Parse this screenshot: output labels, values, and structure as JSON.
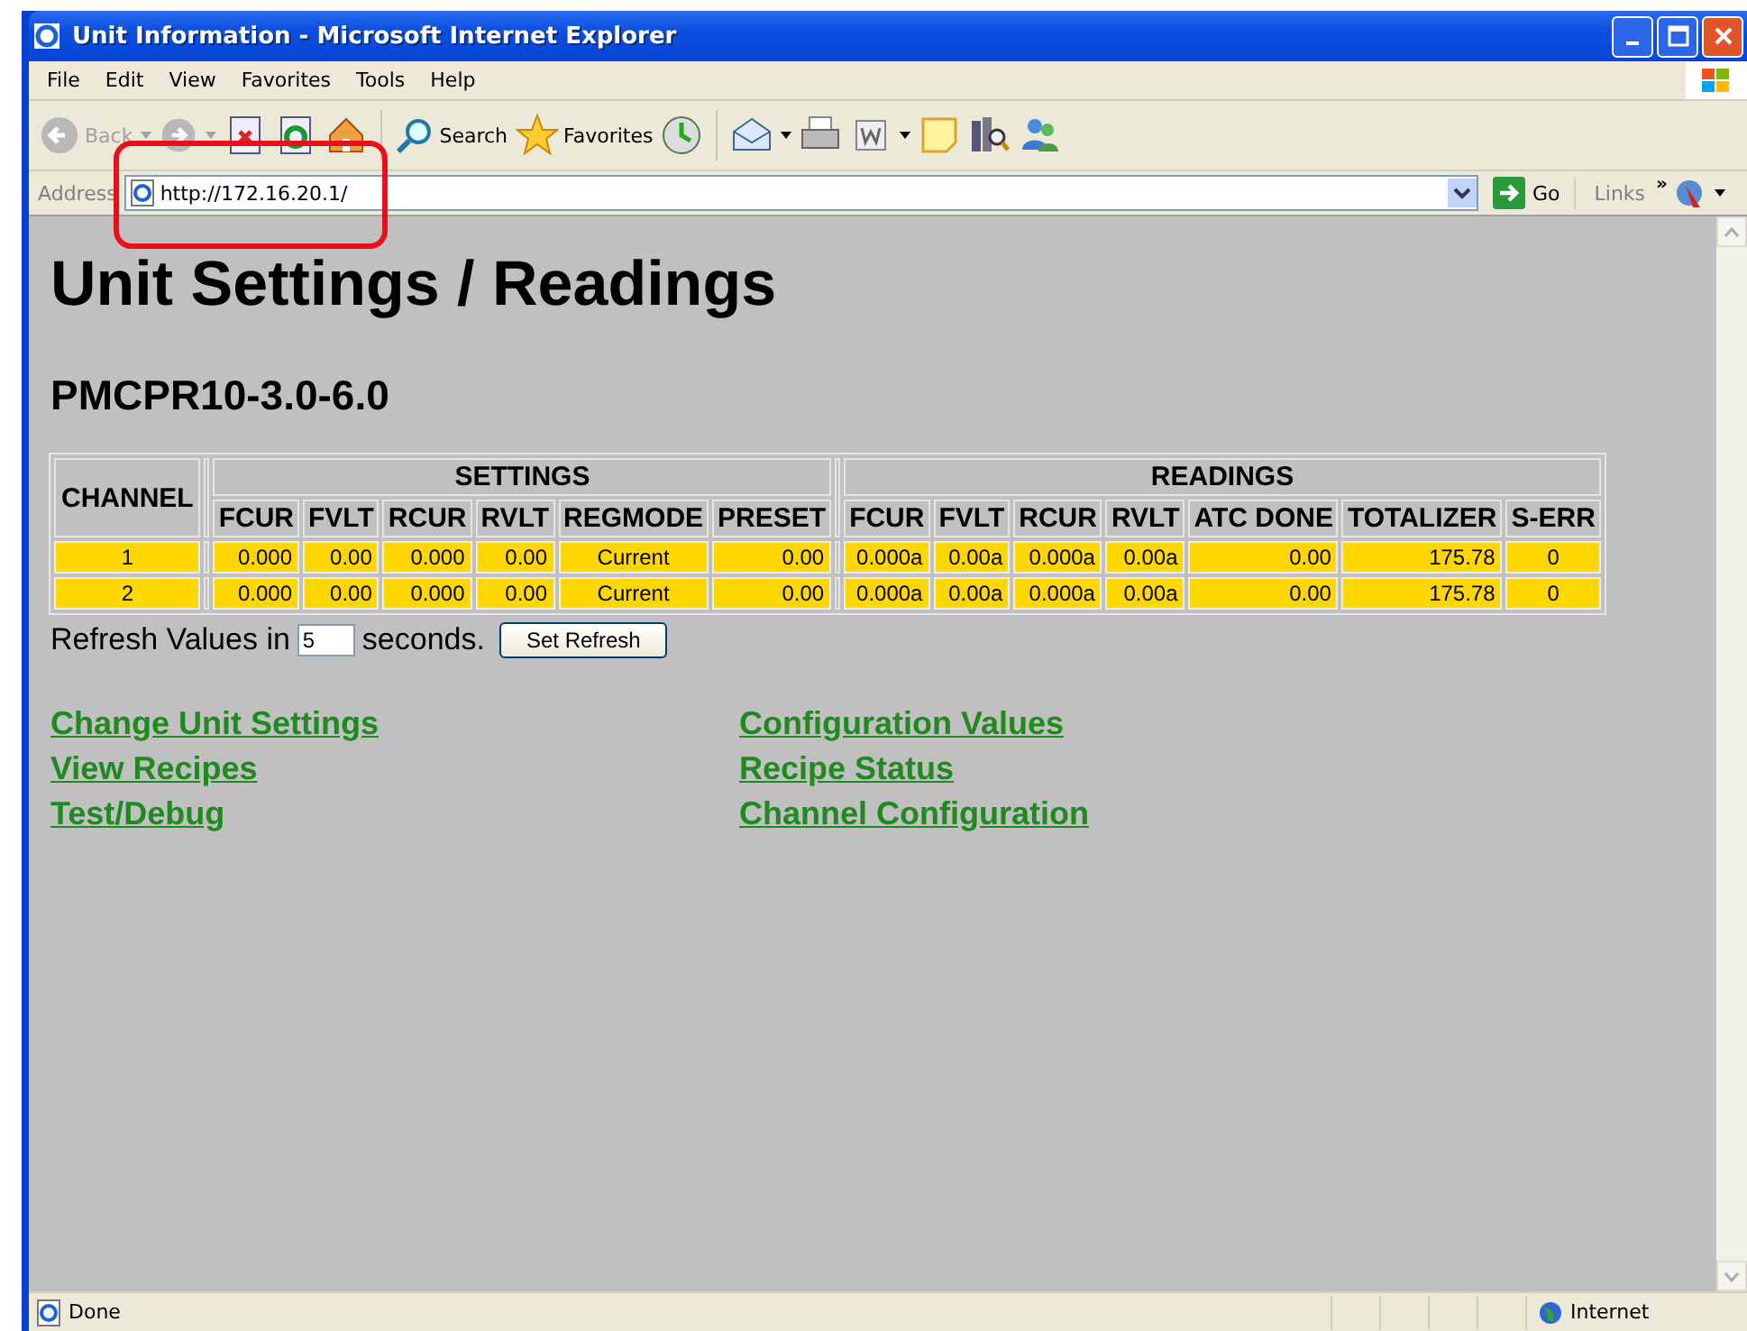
{
  "window": {
    "title": "Unit Information - Microsoft Internet Explorer"
  },
  "menu": [
    "File",
    "Edit",
    "View",
    "Favorites",
    "Tools",
    "Help"
  ],
  "toolbar": {
    "back": "Back",
    "search": "Search",
    "favorites": "Favorites"
  },
  "address_bar": {
    "label": "Address",
    "url": "http://172.16.20.1/",
    "go": "Go",
    "links": "Links",
    "links_more": "»"
  },
  "page": {
    "heading": "Unit Settings / Readings",
    "model": "PMCPR10-3.0-6.0",
    "table": {
      "channel_header": "CHANNEL",
      "groups": [
        {
          "label": "SETTINGS",
          "columns": [
            "FCUR",
            "FVLT",
            "RCUR",
            "RVLT",
            "REGMODE",
            "PRESET"
          ]
        },
        {
          "label": "READINGS",
          "columns": [
            "FCUR",
            "FVLT",
            "RCUR",
            "RVLT",
            "ATC DONE",
            "TOTALIZER",
            "S-ERR"
          ]
        }
      ],
      "rows": [
        {
          "channel": "1",
          "settings": [
            "0.000",
            "0.00",
            "0.000",
            "0.00",
            "Current",
            "0.00"
          ],
          "readings": [
            "0.000a",
            "0.00a",
            "0.000a",
            "0.00a",
            "0.00",
            "175.78",
            "0"
          ]
        },
        {
          "channel": "2",
          "settings": [
            "0.000",
            "0.00",
            "0.000",
            "0.00",
            "Current",
            "0.00"
          ],
          "readings": [
            "0.000a",
            "0.00a",
            "0.000a",
            "0.00a",
            "0.00",
            "175.78",
            "0"
          ]
        }
      ]
    },
    "refresh": {
      "label_before": "Refresh Values in",
      "value": "5",
      "label_after": "seconds.",
      "button": "Set Refresh"
    },
    "links": [
      [
        "Change Unit Settings",
        "View Recipes",
        "Test/Debug"
      ],
      [
        "Configuration Values",
        "Recipe Status",
        "Channel Configuration"
      ]
    ]
  },
  "status_bar": {
    "text": "Done",
    "zone": "Internet"
  }
}
